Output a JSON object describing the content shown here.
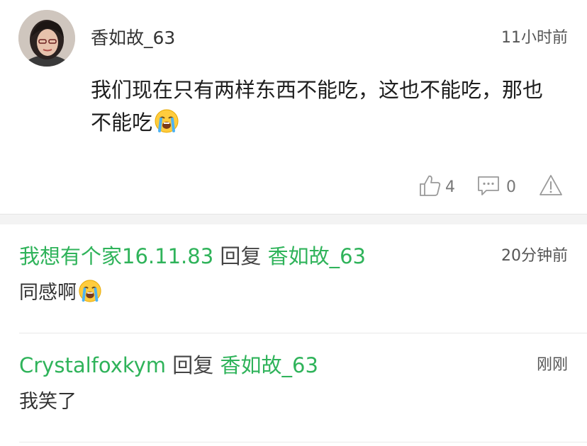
{
  "main_comment": {
    "username": "香如故_63",
    "time": "11小时前",
    "text": "我们现在只有两样东西不能吃，这也不能吃，那也不能吃",
    "emoji": "loudly-crying-face",
    "likes": "4",
    "comments": "0"
  },
  "replies": [
    {
      "author": "我想有个家16.11.83",
      "reply_word": "回复",
      "target": "香如故_63",
      "time": "20分钟前",
      "text": "同感啊",
      "emoji": "loudly-crying-face"
    },
    {
      "author": "Crystalfoxkym",
      "reply_word": "回复",
      "target": "香如故_63",
      "time": "刚刚",
      "text": "我笑了"
    }
  ],
  "colors": {
    "username_green": "#2fb35a",
    "separator": "#f3f3f3",
    "icon_gray": "#9a9a9a"
  }
}
